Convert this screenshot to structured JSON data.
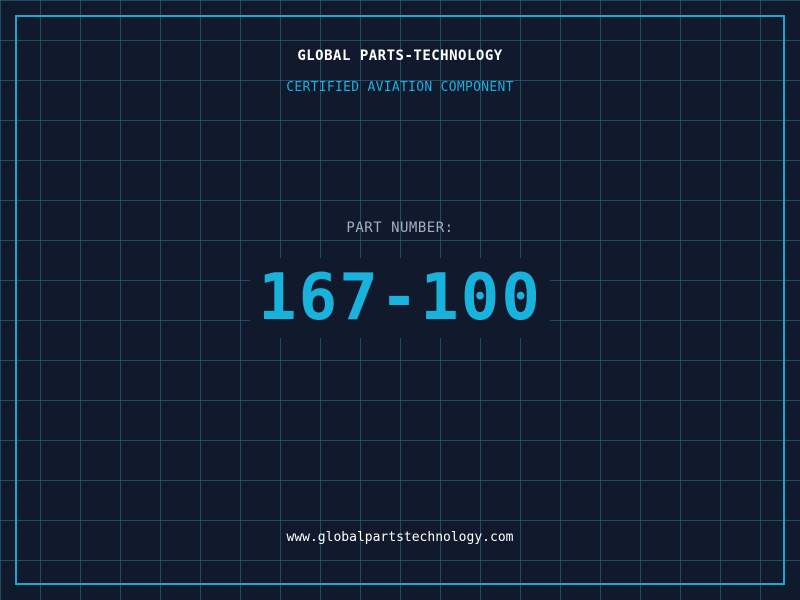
{
  "header": {
    "company_name": "GLOBAL PARTS-TECHNOLOGY",
    "tagline": "CERTIFIED AVIATION COMPONENT"
  },
  "part": {
    "label": "PART NUMBER:",
    "number": "167-100"
  },
  "footer": {
    "website": "www.globalpartstechnology.com"
  },
  "colors": {
    "background": "#101a2c",
    "grid": "#28788f",
    "frame": "#1aa6cf",
    "accent": "#19b2dc",
    "label": "#a4afbe",
    "text": "#ffffff"
  }
}
